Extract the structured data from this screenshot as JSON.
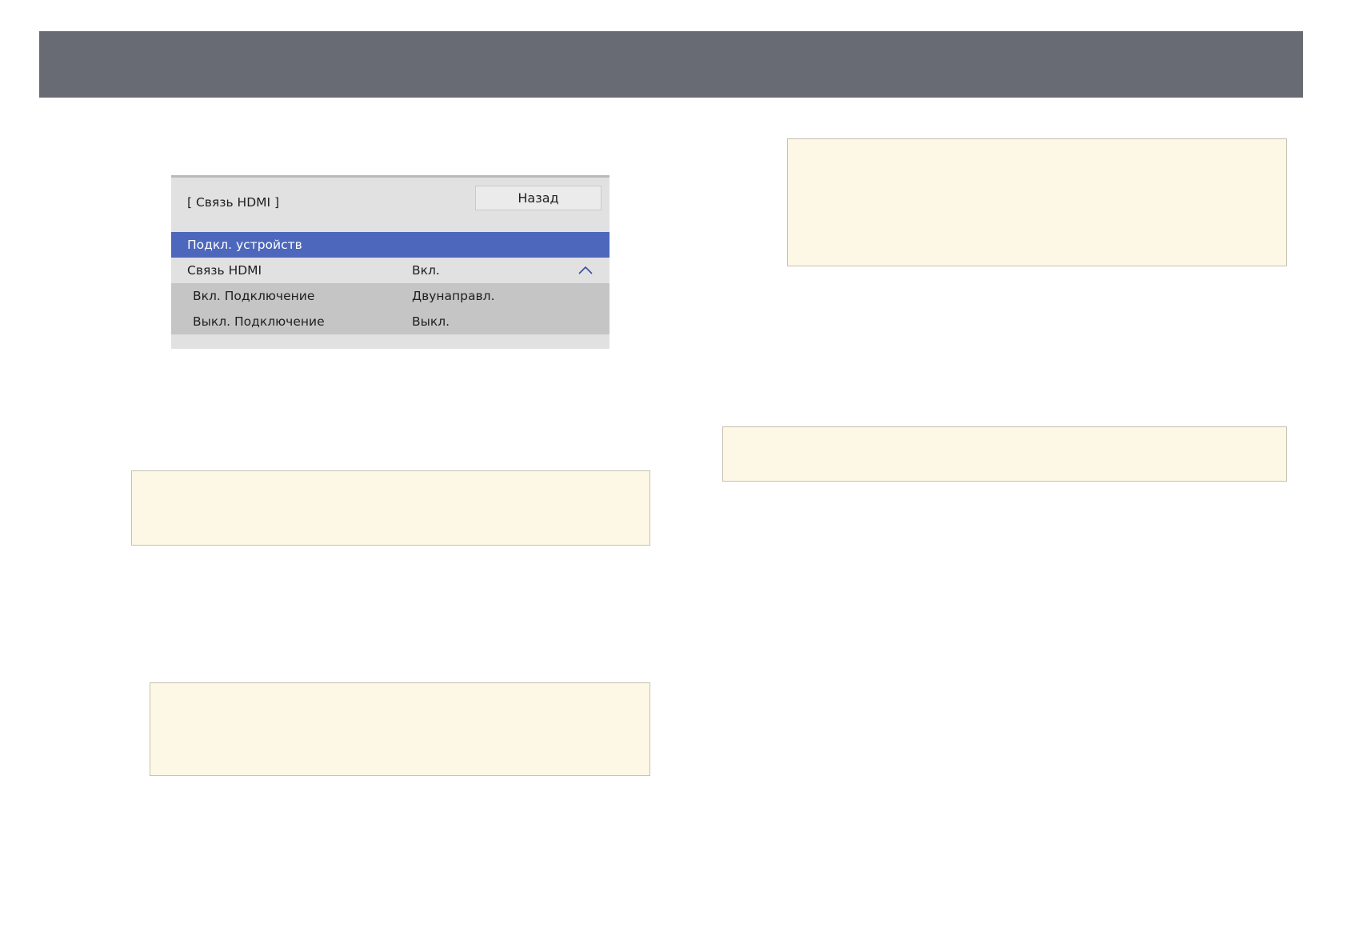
{
  "colors": {
    "header_bar": "#686b73",
    "menu_background": "#e1e1e1",
    "selected_row": "#4d67bc",
    "sub_rows": "#c5c5c5",
    "note_background": "#fdf7e6",
    "note_border": "#c8c1b2"
  },
  "menu": {
    "title": "[ Связь HDMI ]",
    "back_label": "Назад",
    "selected_item": "Подкл. устройств",
    "rows": [
      {
        "label": "Связь HDMI",
        "value": "Вкл.",
        "icon": "chevron-up-icon"
      },
      {
        "label": "Вкл. Подключение",
        "value": "Двунаправл."
      },
      {
        "label": "Выкл. Подключение",
        "value": "Выкл."
      }
    ]
  }
}
